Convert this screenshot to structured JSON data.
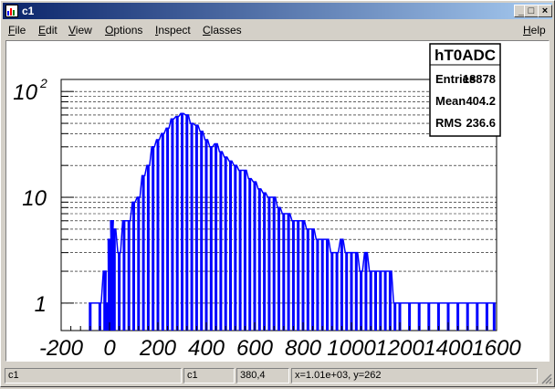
{
  "window": {
    "title": "c1"
  },
  "window_buttons": {
    "minimize": "_",
    "maximize": "□",
    "close": "×"
  },
  "menu": {
    "items": [
      {
        "ul": "F",
        "rest": "ile"
      },
      {
        "ul": "E",
        "rest": "dit"
      },
      {
        "ul": "V",
        "rest": "iew"
      },
      {
        "ul": "O",
        "rest": "ptions"
      },
      {
        "ul": "I",
        "rest": "nspect"
      },
      {
        "ul": "C",
        "rest": "lasses"
      }
    ],
    "help": {
      "ul": "H",
      "rest": "elp"
    }
  },
  "stats": {
    "name": "hT0ADC",
    "rows": [
      {
        "label": "Entries",
        "value": "18878"
      },
      {
        "label": "Mean",
        "value": "404.2"
      },
      {
        "label": "RMS",
        "value": "236.6"
      }
    ]
  },
  "statusbar": {
    "object": "c1",
    "canvas": "c1",
    "pixel": "380,4",
    "coords": "x=1.01e+03, y=262"
  },
  "colors": {
    "histogram": "#0000ff",
    "title_bar": "#0a246a"
  },
  "chart_data": {
    "type": "bar",
    "title": "",
    "xlabel": "",
    "ylabel": "",
    "xlim": [
      -200,
      1600
    ],
    "ylim": [
      0.55,
      130
    ],
    "y_scale": "log",
    "grid_y": true,
    "x_ticks": [
      "-200",
      "0",
      "200",
      "400",
      "600",
      "800",
      "1000",
      "1200",
      "1400",
      "1600"
    ],
    "y_ticks": [
      {
        "value": 1,
        "base": "1",
        "exp": ""
      },
      {
        "value": 10,
        "base": "10",
        "exp": ""
      },
      {
        "value": 100,
        "base": "10",
        "exp": "2"
      }
    ],
    "series": [
      {
        "x": [
          -80,
          -40,
          -20,
          -10,
          0,
          10,
          20,
          40,
          60,
          80,
          100,
          120,
          140,
          160,
          180,
          200,
          220,
          240,
          260,
          280,
          300,
          320,
          340,
          360,
          380,
          400,
          420,
          440,
          460,
          480,
          500,
          520,
          540,
          560,
          580,
          600,
          620,
          640,
          660,
          680,
          700,
          720,
          740,
          760,
          780,
          800,
          820,
          840,
          860,
          880,
          900,
          920,
          940,
          960,
          980,
          1000,
          1020,
          1040,
          1060,
          1080,
          1100,
          1120,
          1140,
          1160,
          1180,
          1200,
          1240,
          1280,
          1320,
          1360,
          1400,
          1440,
          1480,
          1520,
          1560,
          1590
        ],
        "y": [
          1,
          1,
          2,
          1,
          4,
          6,
          5,
          3,
          6,
          6,
          9,
          10,
          16,
          20,
          30,
          35,
          40,
          45,
          55,
          58,
          62,
          60,
          50,
          48,
          42,
          35,
          30,
          32,
          27,
          24,
          22,
          20,
          18,
          18,
          15,
          14,
          12,
          11,
          10,
          10,
          8,
          7,
          7,
          6,
          6,
          6,
          5,
          5,
          4,
          4,
          4,
          3,
          3,
          4,
          3,
          3,
          3,
          2,
          3,
          2,
          2,
          2,
          2,
          2,
          1,
          1,
          1,
          1,
          1,
          1,
          1,
          1,
          1,
          1,
          1,
          1
        ]
      }
    ]
  }
}
